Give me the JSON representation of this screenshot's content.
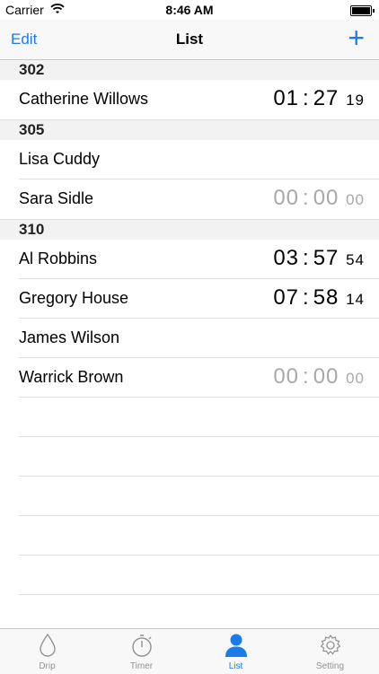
{
  "status_bar": {
    "carrier": "Carrier",
    "time": "8:46 AM"
  },
  "nav": {
    "edit_label": "Edit",
    "title": "List",
    "add_label": "+"
  },
  "sections": [
    {
      "header": "302",
      "rows": [
        {
          "name": "Catherine Willows",
          "timer": {
            "min": "01",
            "colon": ":",
            "sec": "27",
            "hund": "19",
            "idle": false
          }
        }
      ]
    },
    {
      "header": "305",
      "rows": [
        {
          "name": "Lisa Cuddy",
          "timer": null
        },
        {
          "name": "Sara Sidle",
          "timer": {
            "min": "00",
            "colon": ":",
            "sec": "00",
            "hund": "00",
            "idle": true
          }
        }
      ]
    },
    {
      "header": "310",
      "rows": [
        {
          "name": "Al Robbins",
          "timer": {
            "min": "03",
            "colon": ":",
            "sec": "57",
            "hund": "54",
            "idle": false
          }
        },
        {
          "name": "Gregory House",
          "timer": {
            "min": "07",
            "colon": ":",
            "sec": "58",
            "hund": "14",
            "idle": false
          }
        },
        {
          "name": "James Wilson",
          "timer": null
        },
        {
          "name": "Warrick Brown",
          "timer": {
            "min": "00",
            "colon": ":",
            "sec": "00",
            "hund": "00",
            "idle": true
          }
        }
      ]
    }
  ],
  "tabs": [
    {
      "label": "Drip",
      "icon": "drop-icon",
      "active": false
    },
    {
      "label": "Timer",
      "icon": "stopwatch-icon",
      "active": false
    },
    {
      "label": "List",
      "icon": "person-icon",
      "active": true
    },
    {
      "label": "Setting",
      "icon": "gear-icon",
      "active": false
    }
  ],
  "colors": {
    "accent": "#1a7ce8",
    "inactive": "#929292",
    "idle_timer": "#a8a8ac"
  }
}
